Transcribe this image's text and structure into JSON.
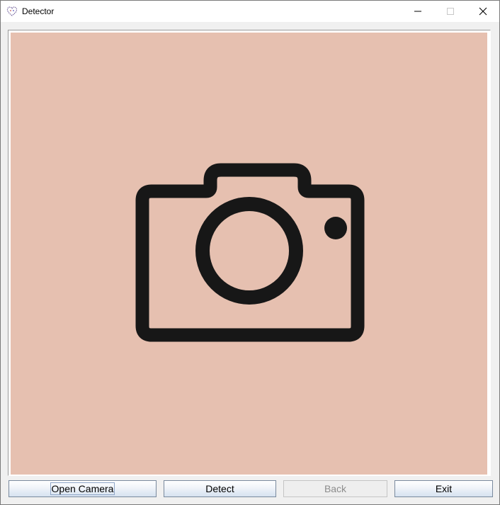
{
  "window": {
    "title": "Detector",
    "icon": "heart-outline-icon"
  },
  "title_controls": {
    "minimize_icon": "minimize-icon",
    "maximize_icon": "maximize-icon",
    "close_icon": "close-icon"
  },
  "preview": {
    "placeholder_icon": "camera-icon",
    "background_color": "#e6c0b0"
  },
  "buttons": {
    "open_camera": "Open Camera",
    "detect": "Detect",
    "back": "Back",
    "exit": "Exit"
  }
}
